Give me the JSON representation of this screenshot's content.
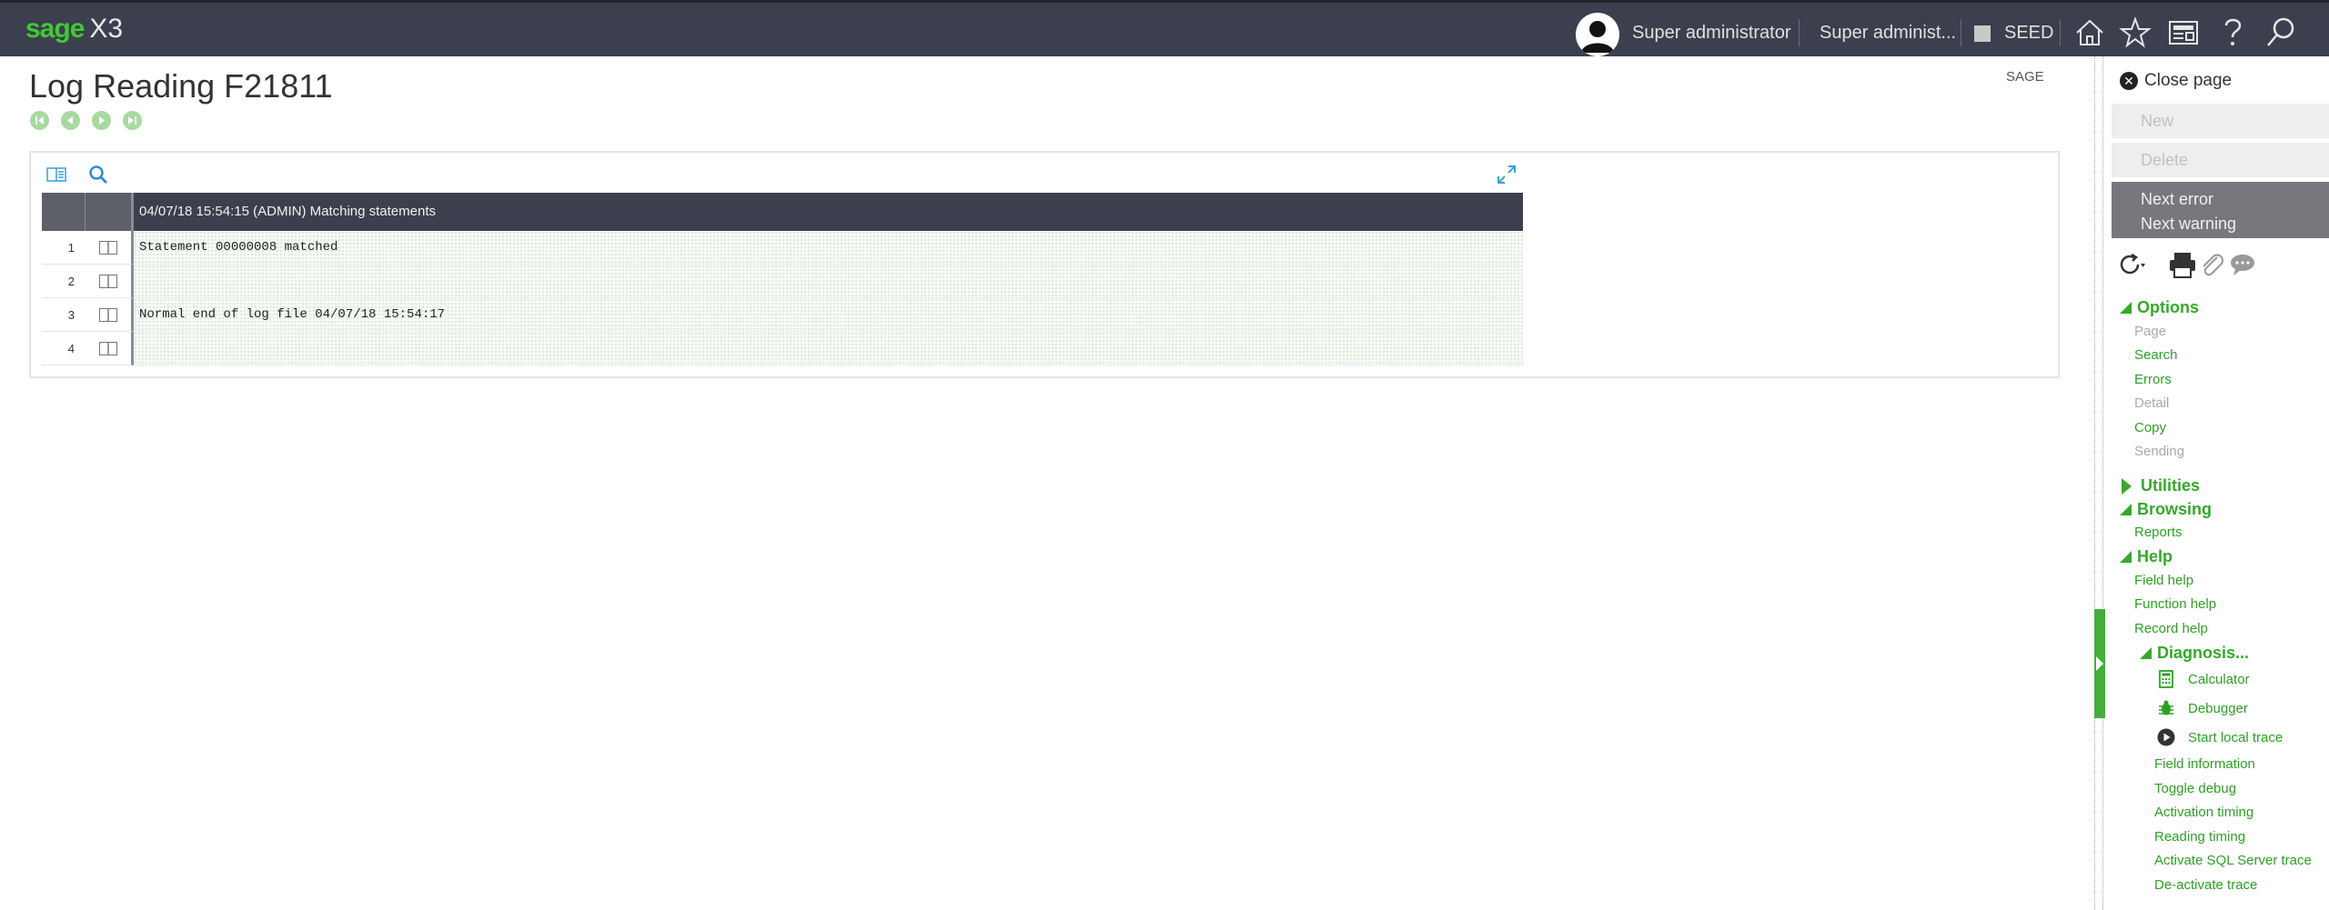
{
  "topbar": {
    "logo_brand": "sage",
    "logo_product": "X3",
    "user_name": "Super administrator",
    "role": "Super administ...",
    "folder": "SEED"
  },
  "page": {
    "title": "Log Reading F21811",
    "subtitle": "SAGE"
  },
  "grid": {
    "column_header": "04/07/18 15:54:15 (ADMIN) Matching statements",
    "rows": [
      {
        "num": "1",
        "text": "Statement 00000008 matched"
      },
      {
        "num": "2",
        "text": ""
      },
      {
        "num": "3",
        "text": "Normal end of log file 04/07/18 15:54:17"
      },
      {
        "num": "4",
        "text": ""
      }
    ]
  },
  "right_panel": {
    "close_page": "Close page",
    "new_label": "New",
    "delete_label": "Delete",
    "next_error": "Next error",
    "next_warning": "Next warning",
    "options_title": "Options",
    "options_items": [
      "Page",
      "Search",
      "Errors",
      "Detail",
      "Copy",
      "Sending"
    ],
    "utilities_title": "Utilities",
    "browsing_title": "Browsing",
    "browsing_items": [
      "Reports"
    ],
    "help_title": "Help",
    "help_items": [
      "Field help",
      "Function help",
      "Record help"
    ],
    "diagnosis_title": "Diagnosis...",
    "diagnosis_icon_items": [
      "Calculator",
      "Debugger",
      "Start local trace"
    ],
    "diagnosis_items": [
      "Field information",
      "Toggle debug",
      "Activation timing",
      "Reading timing",
      "Activate SQL Server trace",
      "De-activate trace"
    ]
  },
  "colors": {
    "topbar_bg": "#3c3f4d",
    "brand_green": "#41c837",
    "menu_green": "#36a82b",
    "grid_header_bg": "#3c3f4d"
  },
  "icons": [
    "home-icon",
    "star-icon",
    "news-icon",
    "help-icon",
    "search-icon",
    "first-record-icon",
    "previous-record-icon",
    "next-record-icon",
    "last-record-icon",
    "refresh-icon",
    "print-icon",
    "attachment-icon",
    "comment-icon",
    "calculator-icon",
    "debugger-icon",
    "play-icon",
    "close-icon"
  ]
}
